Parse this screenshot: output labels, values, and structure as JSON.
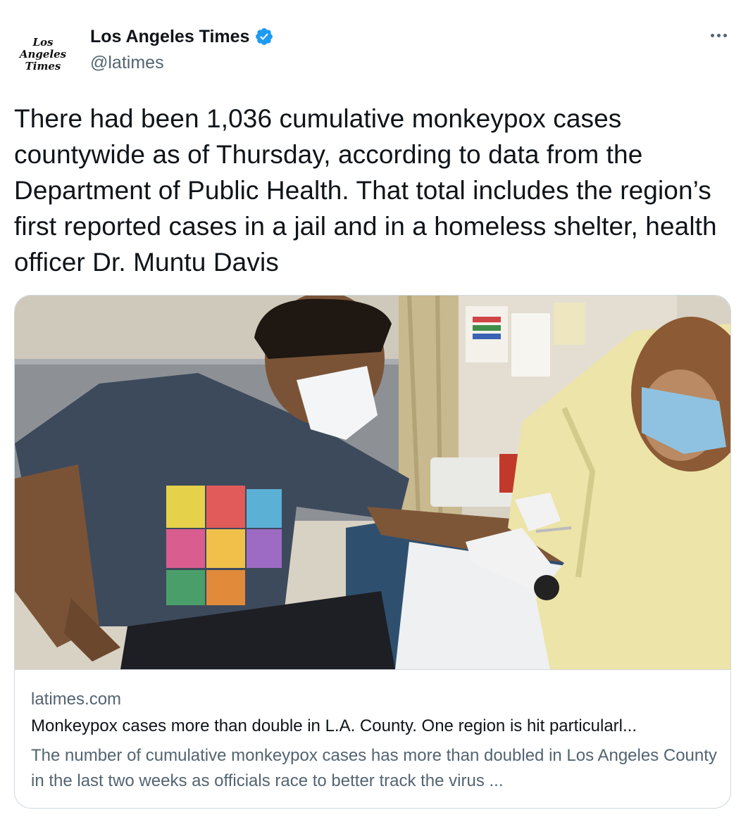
{
  "author": {
    "display_name": "Los Angeles Times",
    "handle": "@latimes",
    "avatar_logo_lines": [
      "Los",
      "Angeles",
      "Times"
    ],
    "verified_icon": "verified-badge-icon"
  },
  "menu": {
    "icon": "more-icon"
  },
  "tweet": {
    "text": "There had been 1,036 cumulative monkeypox cases countywide as of Thursday, according to data from the Department of Public Health. That total includes the region’s first reported cases in a jail and in a homeless shelter, health officer Dr. Muntu Davis"
  },
  "card": {
    "domain": "latimes.com",
    "title": "Monkeypox cases more than double in L.A. County. One region is hit particularl...",
    "description": "The number of cumulative monkeypox cases has more than doubled in Los Angeles County in the last two weeks as officials race to better track the virus ..."
  },
  "colors": {
    "text_primary": "#0f1419",
    "text_secondary": "#536471",
    "border": "#cfd9de",
    "verified_blue": "#1d9bf0"
  }
}
